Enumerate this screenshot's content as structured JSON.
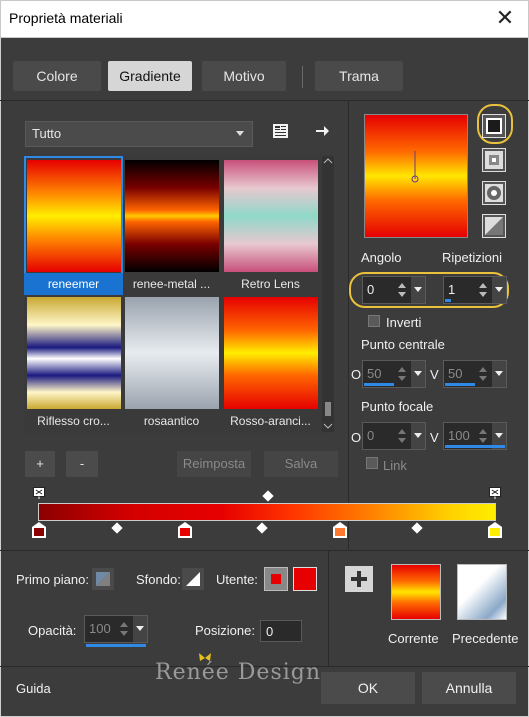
{
  "window": {
    "title": "Proprietà materiali",
    "close_glyph": "✕"
  },
  "tabs": [
    {
      "label": "Colore",
      "active": false
    },
    {
      "label": "Gradiente",
      "active": true
    },
    {
      "label": "Motivo",
      "active": false
    },
    {
      "label": "Trama",
      "active": false
    }
  ],
  "category": {
    "selected": "Tutto"
  },
  "gallery": {
    "items": [
      {
        "label": "reneemer",
        "selected": true,
        "gradient": "linear-gradient(to bottom,#e60000 0%,#ff8800 30%,#ffee00 50%,#ff8800 70%,#e60000 100%)"
      },
      {
        "label": "renee-metal ...",
        "selected": false,
        "gradient": "linear-gradient(to bottom,#000 0%,#7a0000 25%,#ff6600 45%,#ffcc00 50%,#ff6600 55%,#7a0000 75%,#000 100%)"
      },
      {
        "label": "Retro Lens",
        "selected": false,
        "gradient": "linear-gradient(to bottom,#c8507a 0%,#e8c8d0 25%,#8fd8c8 50%,#e8c8d0 75%,#c8507a 100%)"
      },
      {
        "label": "Riflesso cro...",
        "selected": false,
        "gradient": "linear-gradient(to bottom,#c8a830 0%,#fff6c8 25%,#1a1a80 45%,#ffffff 55%,#1a1a80 70%,#fff6c8 85%,#c8a830 100%)"
      },
      {
        "label": "rosaantico",
        "selected": false,
        "gradient": "linear-gradient(to bottom,#9aa3ae 0%,#e8ecf0 50%,#9aa3ae 100%)"
      },
      {
        "label": "Rosso-aranci...",
        "selected": false,
        "gradient": "linear-gradient(to bottom,#e60000 0%,#ff6600 30%,#ffee00 50%,#ff6600 70%,#e60000 100%)"
      }
    ]
  },
  "buttons": {
    "plus": "+",
    "minus": "-",
    "reimposta": "Reimposta",
    "salva": "Salva",
    "ok": "OK",
    "annulla": "Annulla",
    "guida": "Guida"
  },
  "angle": {
    "label": "Angolo",
    "value": "0"
  },
  "repeats": {
    "label": "Ripetizioni",
    "value": "1"
  },
  "invert": {
    "label": "Inverti"
  },
  "center": {
    "label": "Punto centrale",
    "h_label": "O",
    "v_label": "V",
    "h_value": "50",
    "v_value": "50"
  },
  "focal": {
    "label": "Punto focale",
    "h_label": "O",
    "v_label": "V",
    "h_value": "0",
    "v_value": "100"
  },
  "link": {
    "label": "Link"
  },
  "foreground": {
    "label": "Primo piano:"
  },
  "background": {
    "label": "Sfondo:"
  },
  "user": {
    "label": "Utente:",
    "color": "#e60000"
  },
  "opacity": {
    "label": "Opacità:",
    "value": "100"
  },
  "position": {
    "label": "Posizione:",
    "value": "0"
  },
  "current": {
    "label": "Corrente"
  },
  "previous": {
    "label": "Precedente"
  },
  "watermark": {
    "text": "Renée Design"
  }
}
